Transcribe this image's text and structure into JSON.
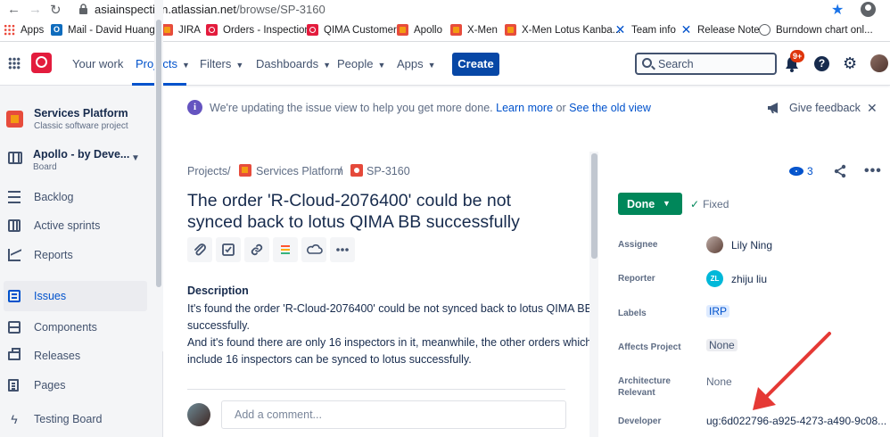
{
  "browser": {
    "url_host": "asiainspection.atlassian.net",
    "url_path": "/browse/SP-3160",
    "bookmarks": [
      {
        "label": "Apps",
        "icon": "apps-grid-icon"
      },
      {
        "label": "Mail - David Huang...",
        "icon": "outlook-icon"
      },
      {
        "label": "JIRA",
        "icon": "jira-icon"
      },
      {
        "label": "Orders - Inspection",
        "icon": "qima-icon"
      },
      {
        "label": "QIMA Customer",
        "icon": "qima-icon"
      },
      {
        "label": "Apollo",
        "icon": "jira-icon"
      },
      {
        "label": "X-Men",
        "icon": "jira-icon"
      },
      {
        "label": "X-Men Lotus Kanba...",
        "icon": "jira-icon"
      },
      {
        "label": "Team info",
        "icon": "confluence-icon"
      },
      {
        "label": "Release Note",
        "icon": "confluence-icon"
      },
      {
        "label": "Burndown chart onl...",
        "icon": "globe-icon"
      }
    ]
  },
  "topnav": {
    "your_work": "Your work",
    "projects": "Projects",
    "filters": "Filters",
    "dashboards": "Dashboards",
    "people": "People",
    "apps": "Apps",
    "create": "Create",
    "search_placeholder": "Search",
    "notification_badge": "9+",
    "help": "?"
  },
  "sidebar": {
    "project_name": "Services Platform",
    "project_type": "Classic software project",
    "board_name": "Apollo - by Deve...",
    "board_type": "Board",
    "items": [
      {
        "label": "Backlog"
      },
      {
        "label": "Active sprints"
      },
      {
        "label": "Reports"
      },
      {
        "label": "Issues"
      },
      {
        "label": "Components"
      },
      {
        "label": "Releases"
      },
      {
        "label": "Pages"
      },
      {
        "label": "Testing Board"
      }
    ]
  },
  "banner": {
    "text": "We're updating the issue view to help you get more done.",
    "learn_more": "Learn more",
    "or": "or",
    "old_view": "See the old view",
    "feedback": "Give feedback"
  },
  "issue": {
    "breadcrumb_projects": "Projects",
    "breadcrumb_project": "Services Platform",
    "breadcrumb_key": "SP-3160",
    "title": "The order 'R-Cloud-2076400' could be not synced back to lotus QIMA BB successfully",
    "description_label": "Description",
    "description_lines": [
      "It's found the order 'R-Cloud-2076400' could be not synced back to lotus QIMA BB",
      "successfully.",
      "And it's found there are only 16 inspectors in it, meanwhile, the other orders which",
      "include 16 inspectors can be synced to lotus successfully."
    ],
    "comment_placeholder": "Add a comment..."
  },
  "details": {
    "watchers": "3",
    "status": "Done",
    "resolution": "Fixed",
    "fields": {
      "assignee_label": "Assignee",
      "assignee": "Lily Ning",
      "reporter_label": "Reporter",
      "reporter_initials": "ZL",
      "reporter": "zhiju liu",
      "labels_label": "Labels",
      "labels": "IRP",
      "affects_label": "Affects Project",
      "affects": "None",
      "arch_label_1": "Architecture",
      "arch_label_2": "Relevant",
      "arch": "None",
      "developer_label": "Developer",
      "developer": "ug:6d022796-a925-4273-a490-9c08..."
    }
  },
  "colors": {
    "accent": "#0052cc",
    "create_button": "#0747a6",
    "done_green": "#00875a",
    "annotation_arrow": "#e53935",
    "logo_red": "#e31c3d"
  }
}
